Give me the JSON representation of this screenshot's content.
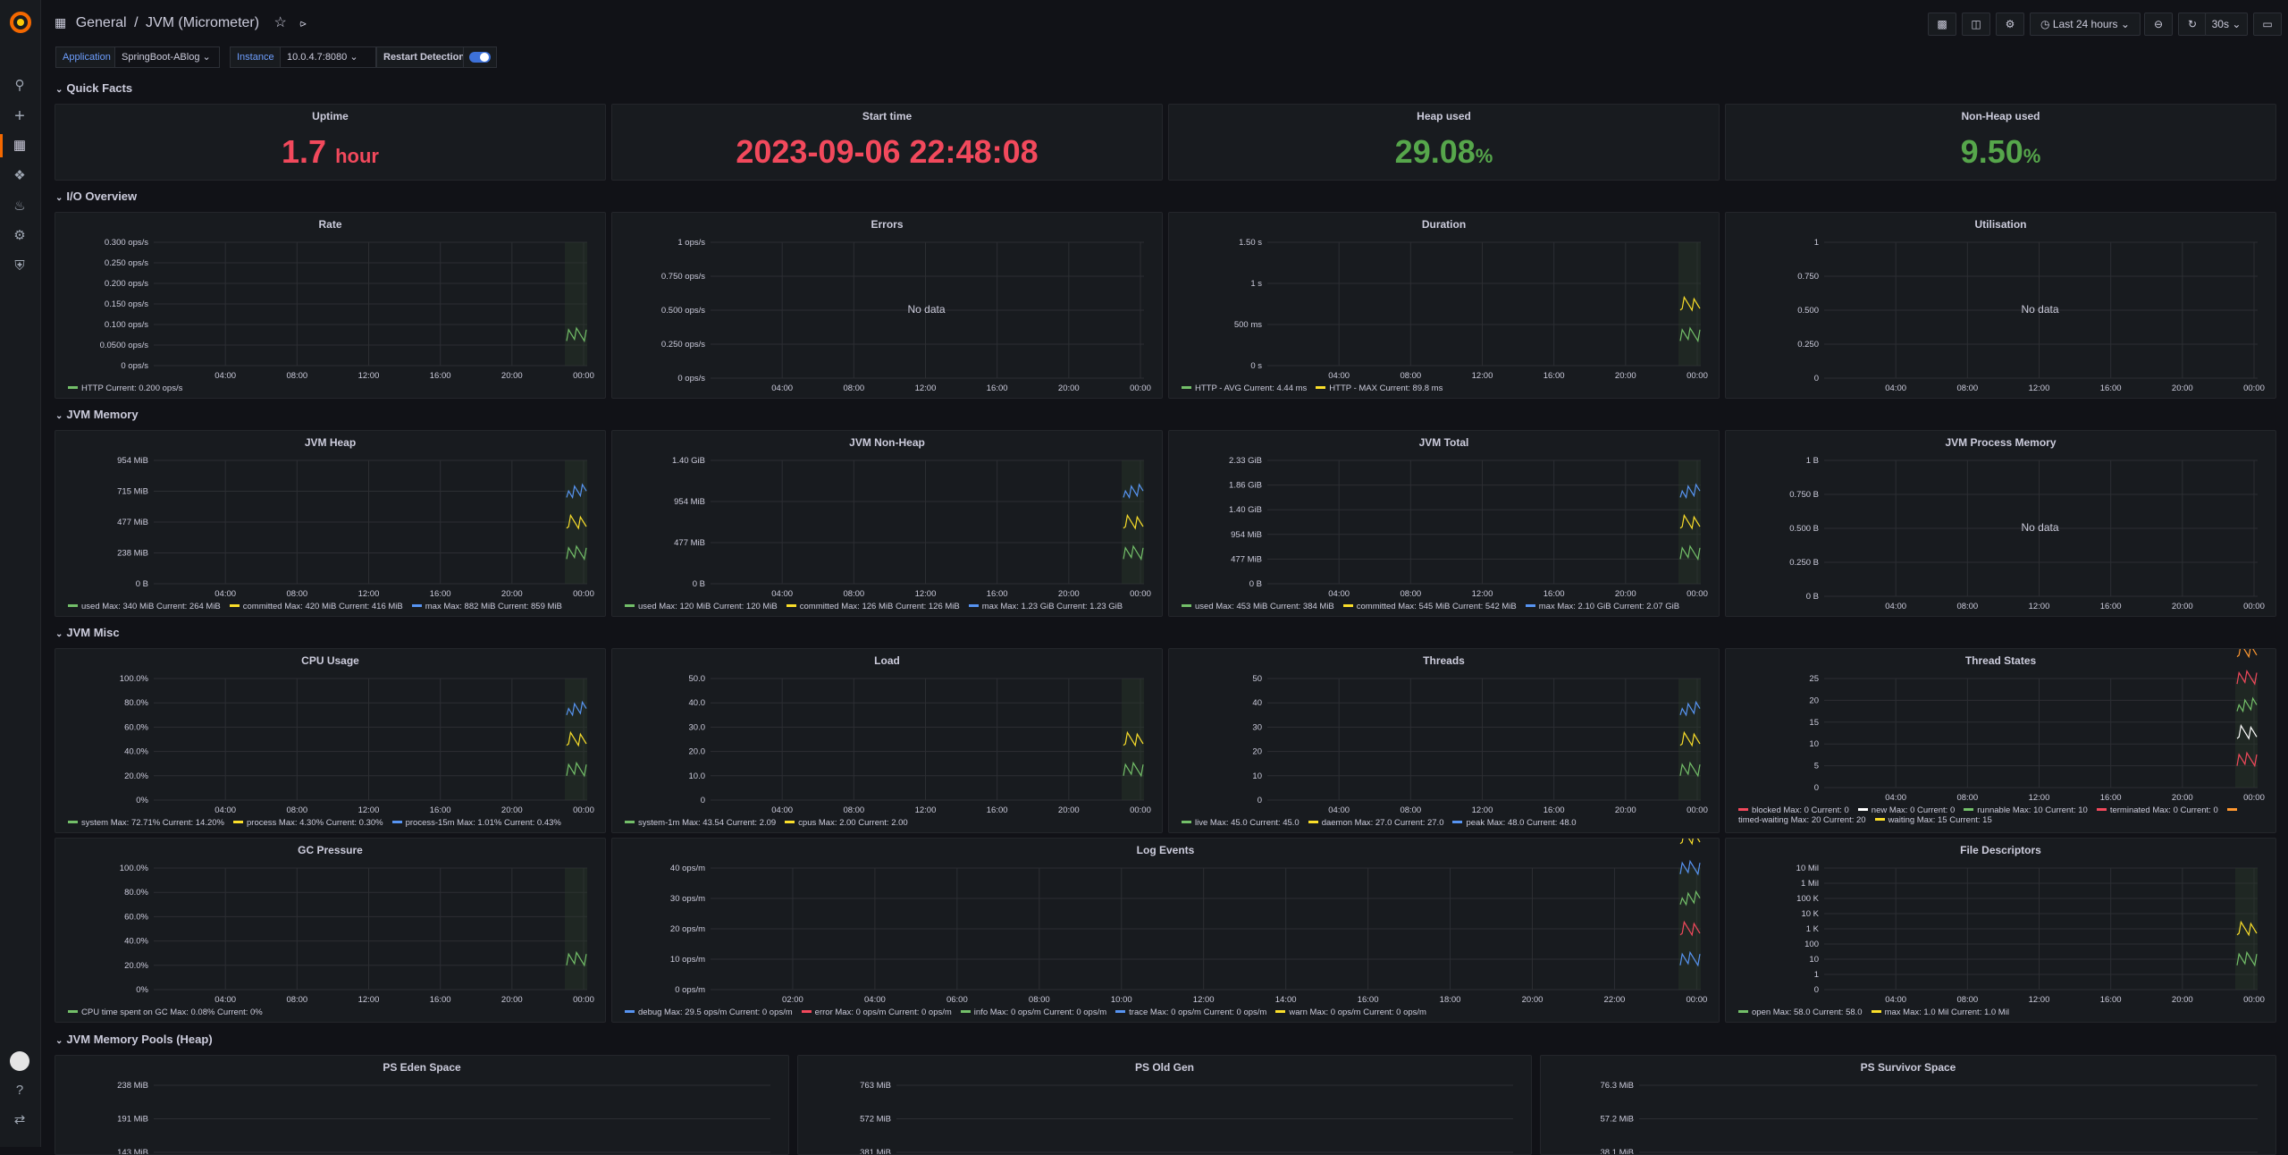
{
  "breadcrumb": {
    "folder": "General",
    "sep": "/",
    "title": "JVM (Micrometer)"
  },
  "time_range": "Last 24 hours",
  "refresh": "30s",
  "variables": {
    "application_label": "Application",
    "application_value": "SpringBoot-ABlog",
    "instance_label": "Instance",
    "instance_value": "10.0.4.7:8080",
    "restart_label": "Restart Detection"
  },
  "rows": {
    "quick_facts": "Quick Facts",
    "io": "I/O Overview",
    "jvm_memory": "JVM Memory",
    "jvm_misc": "JVM Misc",
    "pools_heap": "JVM Memory Pools (Heap)"
  },
  "stats": {
    "uptime": {
      "title": "Uptime",
      "value": "1.7",
      "unit": "hour",
      "color": "#f2495c"
    },
    "start": {
      "title": "Start time",
      "value": "2023-09-06 22:48:08",
      "unit": "",
      "color": "#f2495c"
    },
    "heap": {
      "title": "Heap used",
      "value": "29.08",
      "unit": "%",
      "color": "#56a64b"
    },
    "nonheap": {
      "title": "Non-Heap used",
      "value": "9.50",
      "unit": "%",
      "color": "#56a64b"
    }
  },
  "no_data": "No data",
  "colors": {
    "green": "#73bf69",
    "yellow": "#fade2a",
    "blue": "#5794f2",
    "red": "#f2495c",
    "orange": "#ff9830",
    "white": "#ffffff"
  },
  "panels": [
    {
      "id": "rate",
      "title": "Rate",
      "y_ticks": [
        "0.300 ops/s",
        "0.250 ops/s",
        "0.200 ops/s",
        "0.150 ops/s",
        "0.100 ops/s",
        "0.0500 ops/s",
        "0 ops/s"
      ],
      "x_ticks": [
        "04:00",
        "08:00",
        "12:00",
        "16:00",
        "20:00",
        "00:00"
      ],
      "legend": [
        {
          "color": "green",
          "text": "HTTP  Current: 0.200 ops/s"
        }
      ],
      "chart_data": {
        "type": "line",
        "series": [
          {
            "name": "HTTP",
            "values": [
              0,
              0.2
            ]
          }
        ]
      }
    },
    {
      "id": "errors",
      "title": "Errors",
      "y_ticks": [
        "1 ops/s",
        "0.750 ops/s",
        "0.500 ops/s",
        "0.250 ops/s",
        "0 ops/s"
      ],
      "x_ticks": [
        "04:00",
        "08:00",
        "12:00",
        "16:00",
        "20:00",
        "00:00"
      ],
      "nodata": true,
      "legend": []
    },
    {
      "id": "duration",
      "title": "Duration",
      "y_ticks": [
        "1.50 s",
        "1 s",
        "500 ms",
        "0 s"
      ],
      "x_ticks": [
        "04:00",
        "08:00",
        "12:00",
        "16:00",
        "20:00",
        "00:00"
      ],
      "legend": [
        {
          "color": "green",
          "text": "HTTP - AVG  Current: 4.44 ms"
        },
        {
          "color": "yellow",
          "text": "HTTP - MAX  Current: 89.8 ms"
        }
      ]
    },
    {
      "id": "util",
      "title": "Utilisation",
      "y_ticks": [
        "1",
        "0.750",
        "0.500",
        "0.250",
        "0"
      ],
      "x_ticks": [
        "04:00",
        "08:00",
        "12:00",
        "16:00",
        "20:00",
        "00:00"
      ],
      "nodata": true,
      "legend": []
    },
    {
      "id": "heap",
      "title": "JVM Heap",
      "y_ticks": [
        "954 MiB",
        "715 MiB",
        "477 MiB",
        "238 MiB",
        "0 B"
      ],
      "x_ticks": [
        "04:00",
        "08:00",
        "12:00",
        "16:00",
        "20:00",
        "00:00"
      ],
      "legend": [
        {
          "color": "green",
          "text": "used  Max: 340 MiB  Current: 264 MiB"
        },
        {
          "color": "yellow",
          "text": "committed  Max: 420 MiB  Current: 416 MiB"
        },
        {
          "color": "blue",
          "text": "max  Max: 882 MiB  Current: 859 MiB"
        }
      ]
    },
    {
      "id": "nonheap",
      "title": "JVM Non-Heap",
      "y_ticks": [
        "1.40 GiB",
        "954 MiB",
        "477 MiB",
        "0 B"
      ],
      "x_ticks": [
        "04:00",
        "08:00",
        "12:00",
        "16:00",
        "20:00",
        "00:00"
      ],
      "legend": [
        {
          "color": "green",
          "text": "used  Max: 120 MiB  Current: 120 MiB"
        },
        {
          "color": "yellow",
          "text": "committed  Max: 126 MiB  Current: 126 MiB"
        },
        {
          "color": "blue",
          "text": "max  Max: 1.23 GiB  Current: 1.23 GiB"
        }
      ]
    },
    {
      "id": "total",
      "title": "JVM Total",
      "y_ticks": [
        "2.33 GiB",
        "1.86 GiB",
        "1.40 GiB",
        "954 MiB",
        "477 MiB",
        "0 B"
      ],
      "x_ticks": [
        "04:00",
        "08:00",
        "12:00",
        "16:00",
        "20:00",
        "00:00"
      ],
      "legend": [
        {
          "color": "green",
          "text": "used  Max: 453 MiB  Current: 384 MiB"
        },
        {
          "color": "yellow",
          "text": "committed  Max: 545 MiB  Current: 542 MiB"
        },
        {
          "color": "blue",
          "text": "max  Max: 2.10 GiB  Current: 2.07 GiB"
        }
      ]
    },
    {
      "id": "procmem",
      "title": "JVM Process Memory",
      "y_ticks": [
        "1 B",
        "0.750 B",
        "0.500 B",
        "0.250 B",
        "0 B"
      ],
      "x_ticks": [
        "04:00",
        "08:00",
        "12:00",
        "16:00",
        "20:00",
        "00:00"
      ],
      "nodata": true,
      "legend": []
    },
    {
      "id": "cpu",
      "title": "CPU Usage",
      "y_ticks": [
        "100.0%",
        "80.0%",
        "60.0%",
        "40.0%",
        "20.0%",
        "0%"
      ],
      "x_ticks": [
        "04:00",
        "08:00",
        "12:00",
        "16:00",
        "20:00",
        "00:00"
      ],
      "legend": [
        {
          "color": "green",
          "text": "system  Max: 72.71%  Current: 14.20%"
        },
        {
          "color": "yellow",
          "text": "process  Max: 4.30%  Current: 0.30%"
        },
        {
          "color": "blue",
          "text": "process-15m  Max: 1.01%  Current: 0.43%"
        }
      ]
    },
    {
      "id": "load",
      "title": "Load",
      "y_ticks": [
        "50.0",
        "40.0",
        "30.0",
        "20.0",
        "10.0",
        "0"
      ],
      "x_ticks": [
        "04:00",
        "08:00",
        "12:00",
        "16:00",
        "20:00",
        "00:00"
      ],
      "legend": [
        {
          "color": "green",
          "text": "system-1m  Max: 43.54  Current: 2.09"
        },
        {
          "color": "yellow",
          "text": "cpus  Max: 2.00  Current: 2.00"
        }
      ]
    },
    {
      "id": "threads",
      "title": "Threads",
      "y_ticks": [
        "50",
        "40",
        "30",
        "20",
        "10",
        "0"
      ],
      "x_ticks": [
        "04:00",
        "08:00",
        "12:00",
        "16:00",
        "20:00",
        "00:00"
      ],
      "legend": [
        {
          "color": "green",
          "text": "live  Max: 45.0  Current: 45.0"
        },
        {
          "color": "yellow",
          "text": "daemon  Max: 27.0  Current: 27.0"
        },
        {
          "color": "blue",
          "text": "peak  Max: 48.0  Current: 48.0"
        }
      ]
    },
    {
      "id": "tstates",
      "title": "Thread States",
      "y_ticks": [
        "25",
        "20",
        "15",
        "10",
        "5",
        "0"
      ],
      "x_ticks": [
        "04:00",
        "08:00",
        "12:00",
        "16:00",
        "20:00",
        "00:00"
      ],
      "legend": [
        {
          "color": "red",
          "text": "blocked  Max: 0  Current: 0"
        },
        {
          "color": "white",
          "text": "new  Max: 0  Current: 0"
        },
        {
          "color": "green",
          "text": "runnable  Max: 10  Current: 10"
        },
        {
          "color": "red",
          "text": "terminated  Max: 0  Current: 0"
        },
        {
          "color": "orange",
          "text": "timed-waiting  Max: 20  Current: 20"
        },
        {
          "color": "yellow",
          "text": "waiting  Max: 15  Current: 15"
        }
      ]
    },
    {
      "id": "gc",
      "title": "GC Pressure",
      "y_ticks": [
        "100.0%",
        "80.0%",
        "60.0%",
        "40.0%",
        "20.0%",
        "0%"
      ],
      "x_ticks": [
        "04:00",
        "08:00",
        "12:00",
        "16:00",
        "20:00",
        "00:00"
      ],
      "legend": [
        {
          "color": "green",
          "text": "CPU time spent on GC  Max: 0.08%  Current: 0%"
        }
      ]
    },
    {
      "id": "logs",
      "title": "Log Events",
      "y_ticks": [
        "40 ops/m",
        "30 ops/m",
        "20 ops/m",
        "10 ops/m",
        "0 ops/m"
      ],
      "x_ticks": [
        "02:00",
        "04:00",
        "06:00",
        "08:00",
        "10:00",
        "12:00",
        "14:00",
        "16:00",
        "18:00",
        "20:00",
        "22:00",
        "00:00"
      ],
      "legend": [
        {
          "color": "blue",
          "text": "debug  Max: 29.5 ops/m  Current: 0 ops/m"
        },
        {
          "color": "red",
          "text": "error  Max: 0 ops/m  Current: 0 ops/m"
        },
        {
          "color": "green",
          "text": "info  Max: 0 ops/m  Current: 0 ops/m"
        },
        {
          "color": "blue",
          "text": "trace  Max: 0 ops/m  Current: 0 ops/m"
        },
        {
          "color": "yellow",
          "text": "warn  Max: 0 ops/m  Current: 0 ops/m"
        }
      ]
    },
    {
      "id": "fd",
      "title": "File Descriptors",
      "y_ticks": [
        "10 Mil",
        "1 Mil",
        "100 K",
        "10 K",
        "1 K",
        "100",
        "10",
        "1",
        "0"
      ],
      "x_ticks": [
        "04:00",
        "08:00",
        "12:00",
        "16:00",
        "20:00",
        "00:00"
      ],
      "legend": [
        {
          "color": "green",
          "text": "open  Max: 58.0  Current: 58.0"
        },
        {
          "color": "yellow",
          "text": "max  Max: 1.0 Mil  Current: 1.0 Mil"
        }
      ]
    },
    {
      "id": "eden",
      "title": "PS Eden Space",
      "y_ticks": [
        "238 MiB",
        "191 MiB",
        "143 MiB"
      ],
      "x_ticks": [],
      "legend": []
    },
    {
      "id": "oldgen",
      "title": "PS Old Gen",
      "y_ticks": [
        "763 MiB",
        "572 MiB",
        "381 MiB"
      ],
      "x_ticks": [],
      "legend": []
    },
    {
      "id": "survivor",
      "title": "PS Survivor Space",
      "y_ticks": [
        "76.3 MiB",
        "57.2 MiB",
        "38.1 MiB"
      ],
      "x_ticks": [],
      "legend": []
    }
  ]
}
